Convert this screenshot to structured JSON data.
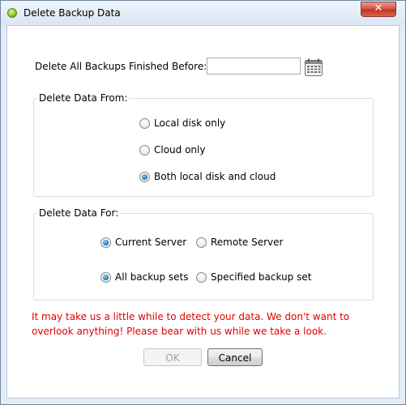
{
  "window": {
    "title": "Delete Backup Data"
  },
  "date_row": {
    "label": "Delete All Backups Finished Before:",
    "value": "",
    "placeholder": ""
  },
  "data_from": {
    "title": "Delete Data From:",
    "options": [
      {
        "label": "Local disk only",
        "checked": false
      },
      {
        "label": "Cloud only",
        "checked": false
      },
      {
        "label": "Both local disk and cloud",
        "checked": true
      }
    ]
  },
  "data_for": {
    "title": "Delete Data For:",
    "server_options": [
      {
        "label": "Current Server",
        "checked": true
      },
      {
        "label": "Remote Server",
        "checked": false
      }
    ],
    "set_options": [
      {
        "label": "All backup sets",
        "checked": true
      },
      {
        "label": "Specified backup set",
        "checked": false
      }
    ]
  },
  "warning": {
    "text": "It may take us a little while to detect your data. We don't want to overlook anything! Please bear with us while we take a look.",
    "color": "#e00000"
  },
  "buttons": {
    "ok": {
      "label": "OK",
      "enabled": false
    },
    "cancel": {
      "label": "Cancel",
      "enabled": true
    }
  },
  "icons": {
    "app": "app-green-orb-icon",
    "close": "close-icon",
    "calendar": "calendar-icon"
  }
}
